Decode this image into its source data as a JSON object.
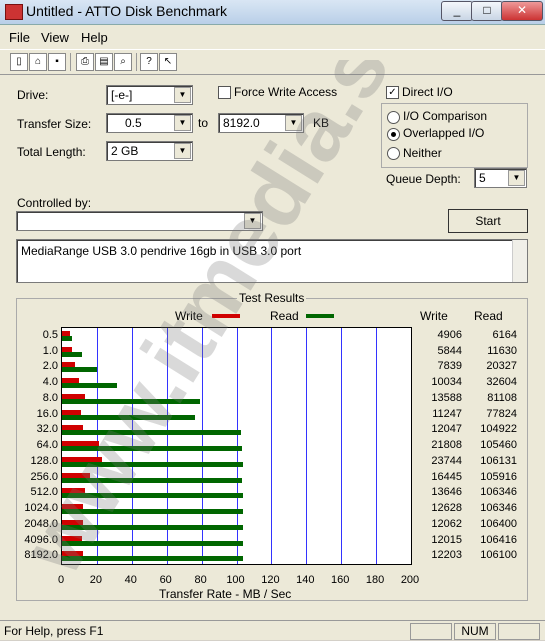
{
  "window": {
    "title": "Untitled - ATTO Disk Benchmark",
    "minimize": "_",
    "maximize": "□",
    "close": "✕"
  },
  "menu": [
    "File",
    "View",
    "Help"
  ],
  "toolbar": [
    "new-icon",
    "open-icon",
    "save-icon",
    "print-icon",
    "print-preview-icon",
    "zoom-icon",
    "help-icon",
    "context-help-icon"
  ],
  "form": {
    "drive_label": "Drive:",
    "drive_value": "[-e-]",
    "force_write_label": "Force Write Access",
    "direct_io_label": "Direct I/O",
    "direct_io_checked": true,
    "transfer_size_label": "Transfer Size:",
    "transfer_from": "0.5",
    "to_label": "to",
    "transfer_to": "8192.0",
    "kb_label": "KB",
    "total_length_label": "Total Length:",
    "total_length_value": "2 GB",
    "io_comparison": "I/O Comparison",
    "overlapped_io": "Overlapped I/O",
    "neither": "Neither",
    "queue_depth_label": "Queue Depth:",
    "queue_depth_value": "5",
    "controlled_by_label": "Controlled by:",
    "controlled_by_value": "",
    "start_button": "Start",
    "description": "MediaRange USB 3.0 pendrive 16gb in USB 3.0 port"
  },
  "results": {
    "title": "Test Results",
    "legend_write": "Write",
    "legend_read": "Read",
    "write_color": "#d00000",
    "read_color": "#006600",
    "col_write": "Write",
    "col_read": "Read",
    "xlabel": "Transfer Rate - MB / Sec"
  },
  "chart_data": {
    "type": "bar",
    "orientation": "horizontal",
    "title": "Test Results",
    "xlabel": "Transfer Rate - MB / Sec",
    "xlim": [
      0,
      200
    ],
    "xticks": [
      "0",
      "20",
      "40",
      "60",
      "80",
      "100",
      "120",
      "140",
      "160",
      "180",
      "200"
    ],
    "categories": [
      "0.5",
      "1.0",
      "2.0",
      "4.0",
      "8.0",
      "16.0",
      "32.0",
      "64.0",
      "128.0",
      "256.0",
      "512.0",
      "1024.0",
      "2048.0",
      "4096.0",
      "8192.0"
    ],
    "series": [
      {
        "name": "Write",
        "values": [
          4.8,
          5.7,
          7.7,
          9.8,
          13.3,
          11.0,
          11.8,
          21.3,
          23.2,
          16.1,
          13.3,
          12.3,
          11.8,
          11.7,
          11.9
        ]
      },
      {
        "name": "Read",
        "values": [
          6.0,
          11.4,
          19.9,
          31.8,
          79.2,
          76.0,
          102.5,
          103.0,
          103.6,
          103.4,
          103.8,
          103.9,
          103.9,
          104.0,
          103.6
        ]
      }
    ],
    "table": {
      "write": [
        "4906",
        "5844",
        "7839",
        "10034",
        "13588",
        "11247",
        "12047",
        "21808",
        "23744",
        "16445",
        "13646",
        "12628",
        "12062",
        "12015",
        "12203"
      ],
      "read": [
        "6164",
        "11630",
        "20327",
        "32604",
        "81108",
        "77824",
        "104922",
        "105460",
        "106131",
        "105916",
        "106346",
        "106346",
        "106400",
        "106416",
        "106100"
      ]
    }
  },
  "statusbar": {
    "text": "For Help, press F1",
    "num": "NUM"
  },
  "watermark": "www.itmedia.sk"
}
